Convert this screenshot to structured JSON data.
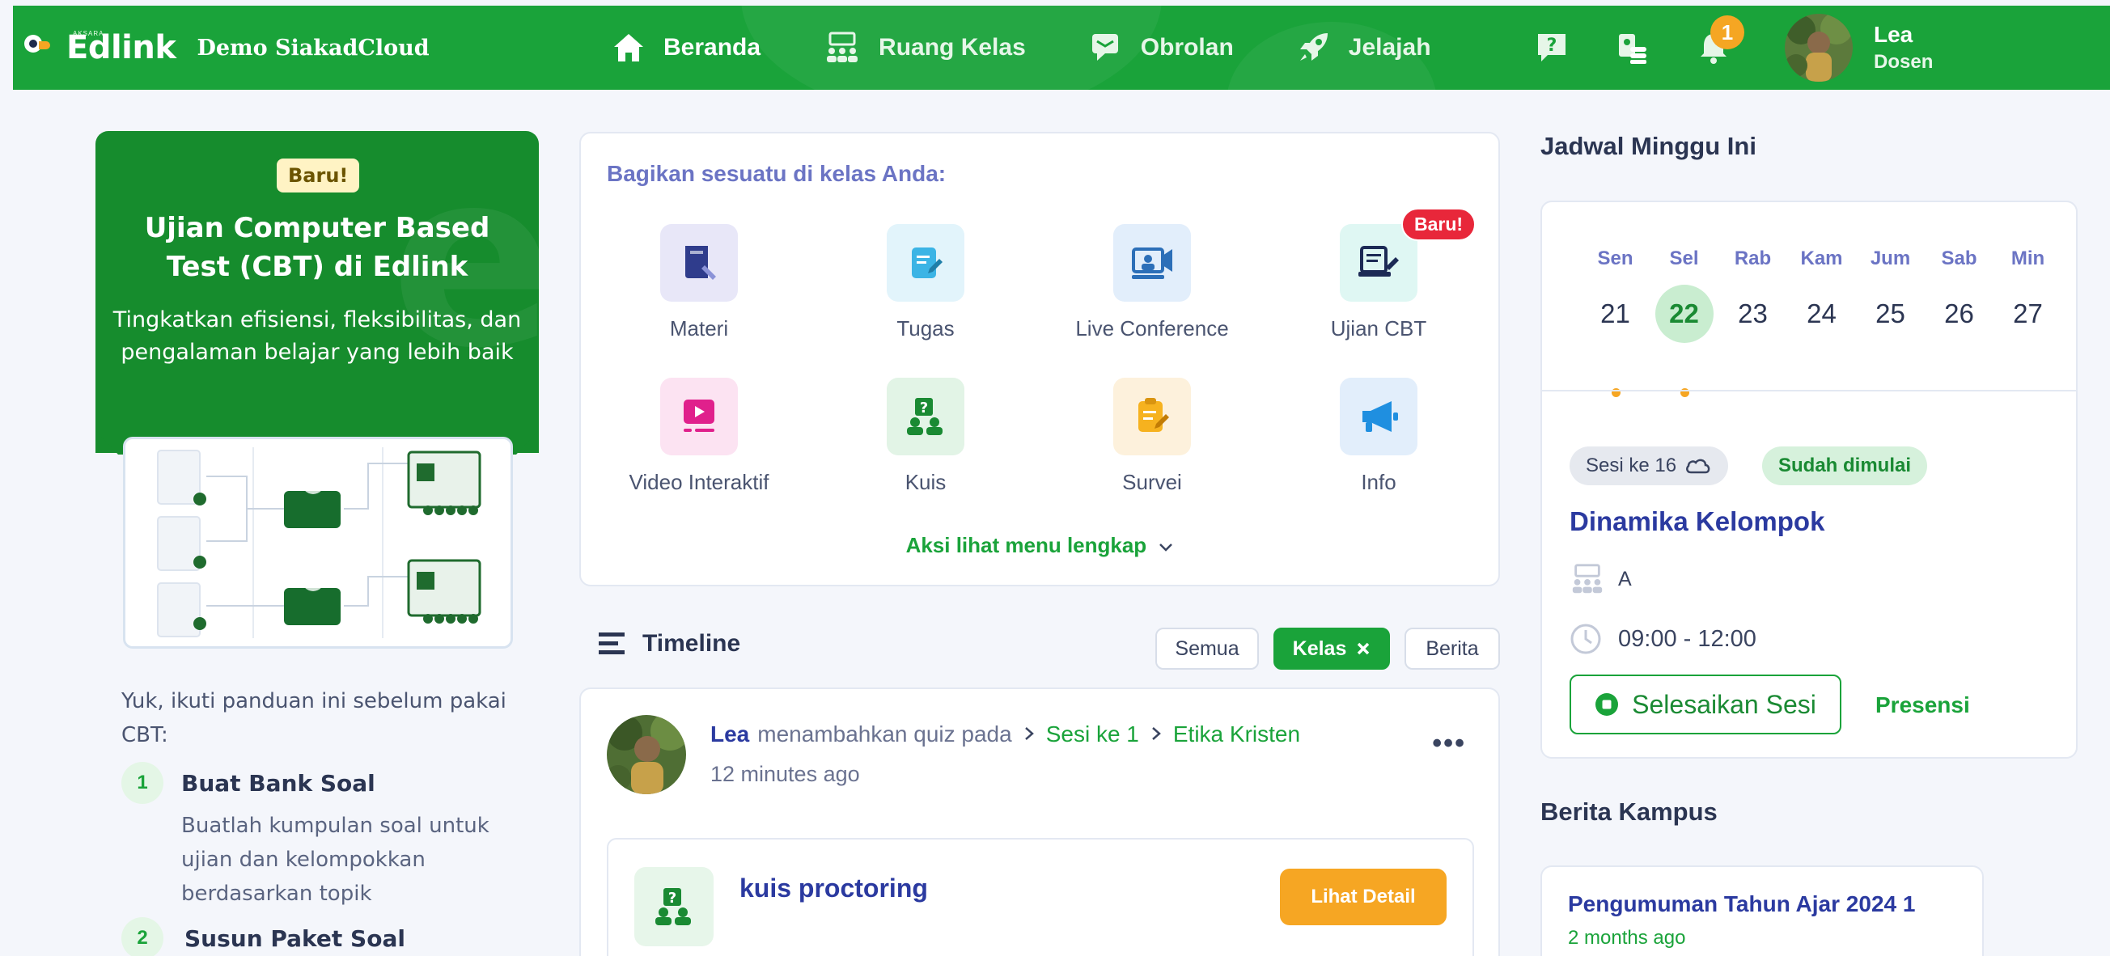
{
  "brand": {
    "tiny": "AKSARA",
    "name": "Edlink",
    "subtitle": "Demo SiakadCloud"
  },
  "nav": [
    {
      "label": "Beranda",
      "icon": "home-icon"
    },
    {
      "label": "Ruang Kelas",
      "icon": "classroom-icon"
    },
    {
      "label": "Obrolan",
      "icon": "chat-icon"
    },
    {
      "label": "Jelajah",
      "icon": "rocket-icon"
    }
  ],
  "topbar": {
    "notification_count": "1",
    "user_name": "Lea",
    "user_role": "Dosen"
  },
  "promo": {
    "badge": "Baru!",
    "title": "Ujian Computer Based Test (CBT) di Edlink",
    "description": "Tingkatkan efisiensi, fleksibilitas, dan pengalaman belajar yang lebih baik"
  },
  "guide": {
    "intro": "Yuk, ikuti panduan ini sebelum pakai CBT:",
    "steps": [
      {
        "num": "1",
        "title": "Buat Bank Soal",
        "desc": "Buatlah kumpulan soal untuk ujian dan kelompokkan berdasarkan topik"
      },
      {
        "num": "2",
        "title": "Susun Paket Soal"
      }
    ]
  },
  "share": {
    "title": "Bagikan sesuatu di kelas Anda:",
    "items": [
      {
        "label": "Materi",
        "icon": "book-icon"
      },
      {
        "label": "Tugas",
        "icon": "assignment-icon"
      },
      {
        "label": "Live Conference",
        "icon": "video-conference-icon"
      },
      {
        "label": "Ujian CBT",
        "icon": "cbt-exam-icon",
        "badge": "Baru!"
      },
      {
        "label": "Video Interaktif",
        "icon": "play-video-icon"
      },
      {
        "label": "Kuis",
        "icon": "quiz-icon"
      },
      {
        "label": "Survei",
        "icon": "survey-icon"
      },
      {
        "label": "Info",
        "icon": "megaphone-icon"
      }
    ],
    "more_link": "Aksi lihat menu lengkap"
  },
  "timeline": {
    "title": "Timeline",
    "filters": [
      {
        "label": "Semua",
        "active": false
      },
      {
        "label": "Kelas",
        "active": true
      },
      {
        "label": "Berita",
        "active": false
      }
    ],
    "post": {
      "author": "Lea",
      "action": "menambahkan quiz pada",
      "session": "Sesi ke 1",
      "course": "Etika Kristen",
      "time": "12 minutes ago",
      "quiz_title": "kuis proctoring",
      "detail_button": "Lihat Detail"
    }
  },
  "schedule": {
    "title": "Jadwal Minggu Ini",
    "days": [
      {
        "name": "Sen",
        "num": "21",
        "dot": true,
        "selected": false
      },
      {
        "name": "Sel",
        "num": "22",
        "dot": true,
        "selected": true
      },
      {
        "name": "Rab",
        "num": "23",
        "dot": false,
        "selected": false
      },
      {
        "name": "Kam",
        "num": "24",
        "dot": false,
        "selected": false
      },
      {
        "name": "Jum",
        "num": "25",
        "dot": false,
        "selected": false
      },
      {
        "name": "Sab",
        "num": "26",
        "dot": false,
        "selected": false
      },
      {
        "name": "Min",
        "num": "27",
        "dot": false,
        "selected": false
      }
    ],
    "session_chip": "Sesi ke 16",
    "status_chip": "Sudah dimulai",
    "class_name": "Dinamika Kelompok",
    "class_group": "A",
    "time": "09:00 - 12:00",
    "finish_button": "Selesaikan Sesi",
    "presence_link": "Presensi"
  },
  "news": {
    "title": "Berita Kampus",
    "items": [
      {
        "title": "Pengumuman Tahun Ajar 2024 1",
        "time": "2 months ago"
      }
    ]
  },
  "colors": {
    "primary": "#1aa33a",
    "promo": "#168c2d",
    "accent": "#f6a623",
    "navy": "#2b3aa0",
    "badge_red": "#e8273a"
  }
}
